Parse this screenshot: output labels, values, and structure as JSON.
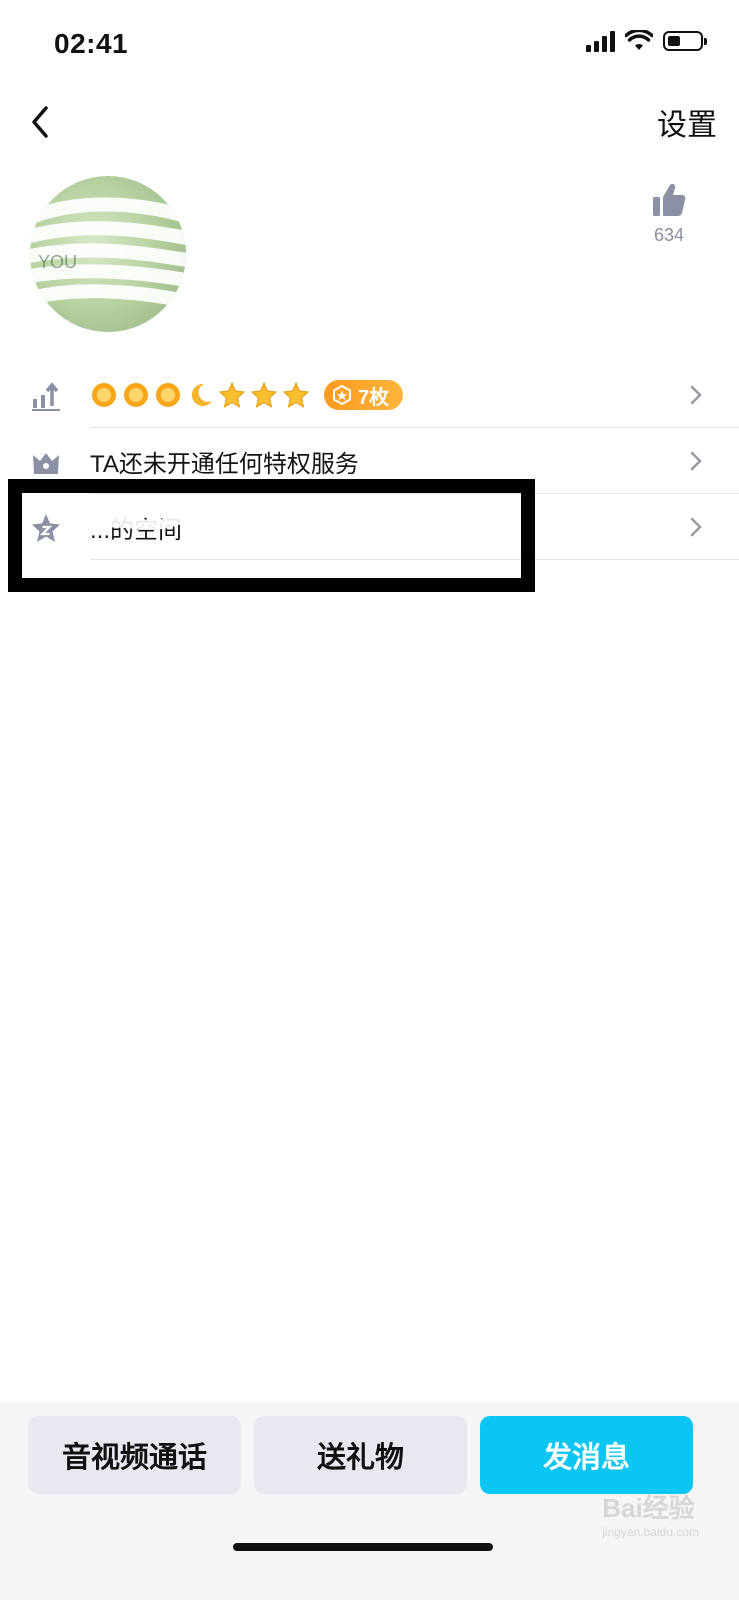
{
  "status_bar": {
    "time": "02:41"
  },
  "nav": {
    "settings_label": "设置"
  },
  "profile": {
    "like_count": "634"
  },
  "list": {
    "level": {
      "badge_count": "7枚"
    },
    "privilege": {
      "label": "TA还未开通任何特权服务"
    },
    "space": {
      "label": "...的空间"
    }
  },
  "actions": {
    "call_label": "音视频通话",
    "gift_label": "送礼物",
    "message_label": "发消息"
  },
  "watermark": {
    "brand": "Bai经验",
    "url": "jingyan.baidu.com"
  },
  "colors": {
    "accent": "#0bc5f3",
    "badge": "#ff9a1d",
    "icon_gray": "#8c90a4"
  }
}
